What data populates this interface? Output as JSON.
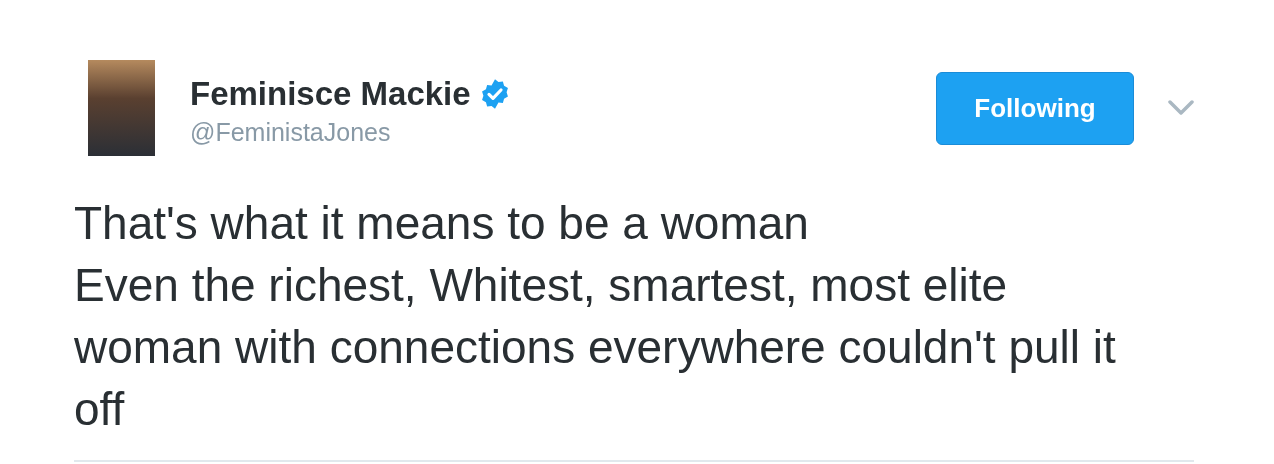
{
  "author": {
    "name": "Feminisce Mackie",
    "handle": "@FeministaJones",
    "verified": true
  },
  "follow_button": {
    "label": "Following",
    "following": true
  },
  "tweet": {
    "text": "That's what it means to be a woman\nEven the richest, Whitest, smartest, most elite woman with connections everywhere couldn't pull it off"
  }
}
